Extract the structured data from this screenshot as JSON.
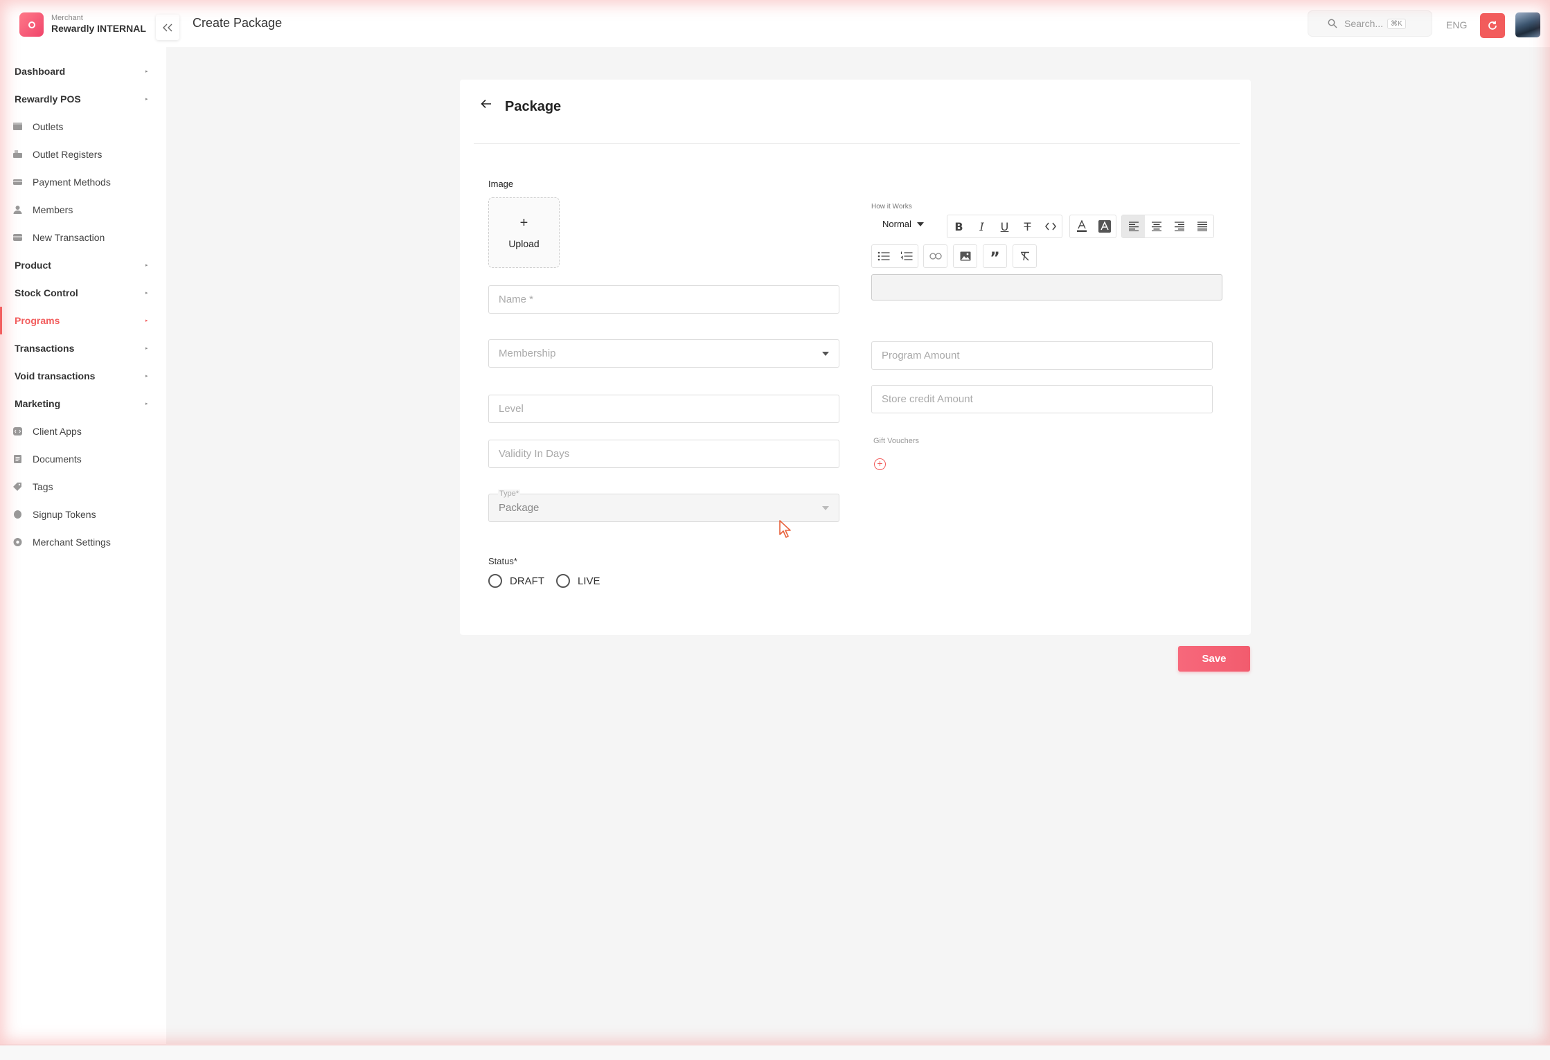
{
  "brand": {
    "caption": "Merchant",
    "name": "Rewardly INTERNAL",
    "accent": "#f25c5c"
  },
  "header": {
    "title": "Create Package",
    "search_placeholder": "Search...",
    "search_shortcut": "⌘K",
    "language": "ENG"
  },
  "sidebar": {
    "items": [
      {
        "label": "Dashboard",
        "type": "group"
      },
      {
        "label": "Rewardly POS",
        "type": "group"
      },
      {
        "label": "Outlets",
        "type": "sub",
        "icon": "store-icon"
      },
      {
        "label": "Outlet Registers",
        "type": "sub",
        "icon": "register-icon"
      },
      {
        "label": "Payment Methods",
        "type": "sub",
        "icon": "payment-icon"
      },
      {
        "label": "Members",
        "type": "sub",
        "icon": "user-icon"
      },
      {
        "label": "New Transaction",
        "type": "sub",
        "icon": "card-icon"
      },
      {
        "label": "Product",
        "type": "group"
      },
      {
        "label": "Stock Control",
        "type": "group"
      },
      {
        "label": "Programs",
        "type": "group",
        "active": true
      },
      {
        "label": "Transactions",
        "type": "group"
      },
      {
        "label": "Void transactions",
        "type": "group"
      },
      {
        "label": "Marketing",
        "type": "group"
      },
      {
        "label": "Client Apps",
        "type": "sub",
        "icon": "code-icon"
      },
      {
        "label": "Documents",
        "type": "sub",
        "icon": "document-icon"
      },
      {
        "label": "Tags",
        "type": "sub",
        "icon": "tag-icon"
      },
      {
        "label": "Signup Tokens",
        "type": "sub",
        "icon": "token-icon"
      },
      {
        "label": "Merchant Settings",
        "type": "sub",
        "icon": "settings-icon"
      }
    ]
  },
  "form": {
    "title": "Package",
    "image_label": "Image",
    "upload_plus": "+",
    "upload_label": "Upload",
    "name_placeholder": "Name *",
    "membership_placeholder": "Membership",
    "level_placeholder": "Level",
    "validity_placeholder": "Validity In Days",
    "type_label": "Type*",
    "type_value": "Package",
    "status_label": "Status*",
    "status_options": [
      "DRAFT",
      "LIVE"
    ],
    "how_it_works_label": "How it Works",
    "editor_style": "Normal",
    "program_amount_placeholder": "Program Amount",
    "store_credit_placeholder": "Store credit Amount",
    "gift_vouchers_label": "Gift Vouchers",
    "gift_add": "+",
    "save_label": "Save"
  }
}
